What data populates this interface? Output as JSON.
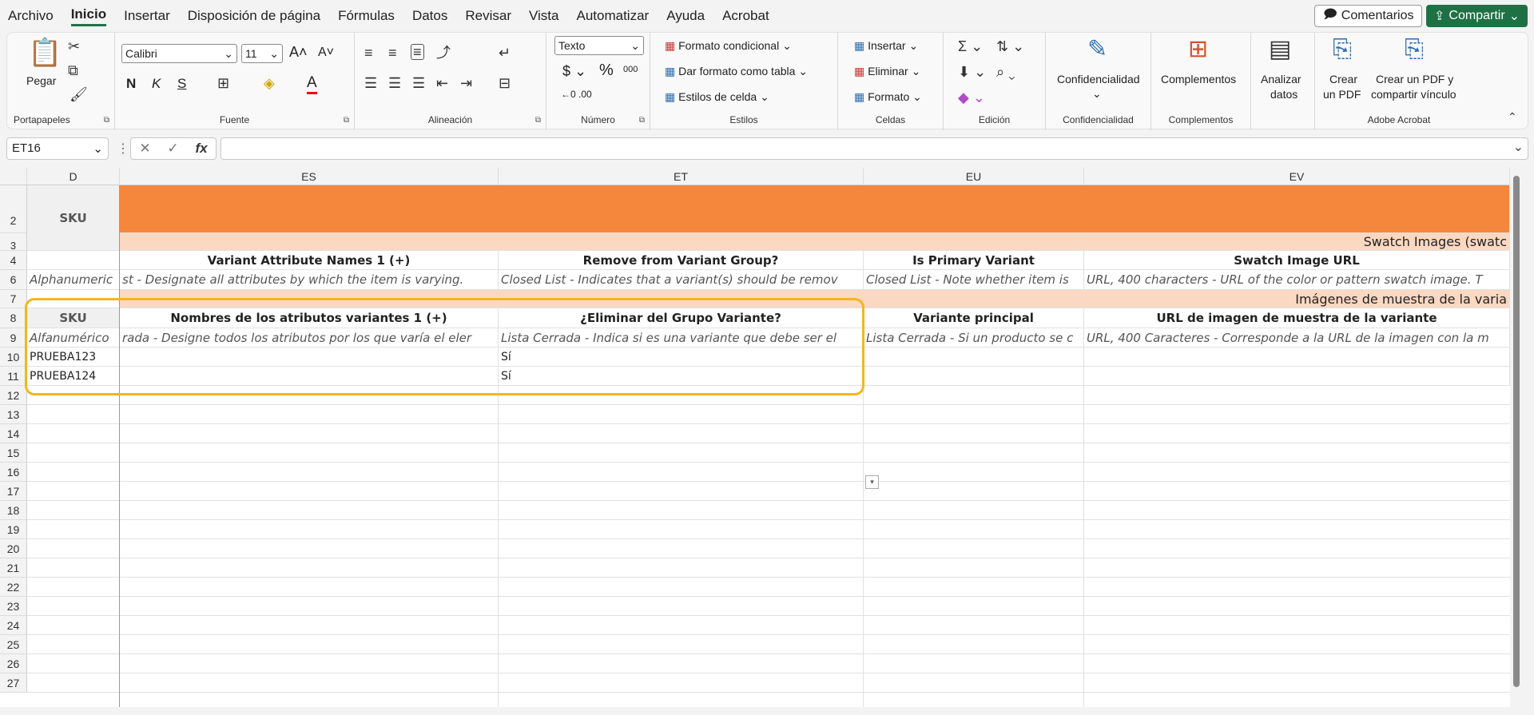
{
  "menu": {
    "items": [
      "Archivo",
      "Inicio",
      "Insertar",
      "Disposición de página",
      "Fórmulas",
      "Datos",
      "Revisar",
      "Vista",
      "Automatizar",
      "Ayuda",
      "Acrobat"
    ],
    "active": "Inicio",
    "comments_label": "Comentarios",
    "share_label": "Compartir"
  },
  "ribbon": {
    "clipboard": {
      "paste_label": "Pegar",
      "group_label": "Portapapeles"
    },
    "font": {
      "font_name": "Calibri",
      "font_size": "11",
      "bold": "N",
      "italic": "K",
      "underline": "S",
      "group_label": "Fuente"
    },
    "alignment": {
      "group_label": "Alineación"
    },
    "number": {
      "format": "Texto",
      "group_label": "Número"
    },
    "styles": {
      "conditional": "Formato condicional",
      "table": "Dar formato como tabla",
      "cell_styles": "Estilos de celda",
      "group_label": "Estilos"
    },
    "cells": {
      "insert": "Insertar",
      "delete": "Eliminar",
      "format": "Formato",
      "group_label": "Celdas"
    },
    "editing": {
      "group_label": "Edición"
    },
    "sensitivity": {
      "label": "Confidencialidad",
      "group_label": "Confidencialidad"
    },
    "addins": {
      "label": "Complementos",
      "group_label": "Complementos"
    },
    "analyze": {
      "label1": "Analizar",
      "label2": "datos"
    },
    "acrobat": {
      "create1": "Crear",
      "create2": "un PDF",
      "share1": "Crear un PDF y",
      "share2": "compartir vínculo",
      "group_label": "Adobe Acrobat"
    }
  },
  "formula_bar": {
    "name_box": "ET16",
    "fx": "fx",
    "formula": ""
  },
  "grid": {
    "columns": [
      "D",
      "ES",
      "ET",
      "EU",
      "EV"
    ],
    "rows": [
      "2",
      "3",
      "4",
      "6",
      "7",
      "8",
      "9",
      "10",
      "11",
      "12",
      "13",
      "14",
      "15",
      "16",
      "17",
      "18",
      "19",
      "20",
      "21",
      "22",
      "23",
      "24",
      "25",
      "26",
      "27"
    ],
    "sku_label": "SKU",
    "row3_ev": "Swatch Images (swatc",
    "row4": {
      "es": "Variant Attribute Names 1 (+)",
      "et": "Remove from Variant Group?",
      "eu": "Is Primary Variant",
      "ev": "Swatch Image URL"
    },
    "row6": {
      "d": "Alphanumeric",
      "es": "st - Designate all attributes by which the item is varying. ",
      "et": "Closed List - Indicates that a variant(s) should be remov",
      "eu": "Closed List - Note whether item is",
      "ev": "URL, 400 characters - URL of the color or pattern swatch image. T"
    },
    "row7_ev": "Imágenes de muestra de la varia",
    "row8": {
      "es": "Nombres de los atributos variantes 1 (+)",
      "et": "¿Eliminar del Grupo Variante?",
      "eu": "Variante principal",
      "ev": "URL de imagen de muestra de la variante"
    },
    "row9": {
      "d": "Alfanumérico",
      "es": "rada - Designe todos los atributos por los que varía el eler",
      "et": "Lista Cerrada - Indica si es una variante que debe ser el",
      "eu": "Lista Cerrada - Si un producto se c",
      "ev": "URL, 400 Caracteres - Corresponde a la URL de la imagen con la m"
    },
    "row10": {
      "d": "PRUEBA123",
      "et": "Sí"
    },
    "row11": {
      "d": "PRUEBA124",
      "et": "Sí"
    }
  },
  "colors": {
    "orange": "#f4873b",
    "peach": "#fbd8c1",
    "highlight": "#f6b51c",
    "accent": "#1e7145"
  }
}
